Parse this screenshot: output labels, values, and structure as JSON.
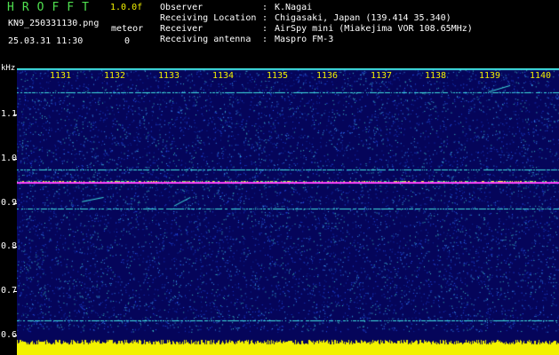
{
  "header": {
    "app_title": "HROFFT",
    "version": "1.0.0f",
    "filename": "KN9_250331130.png",
    "meteor_label": "meteor",
    "timestamp": "25.03.31 11:30",
    "meteor_count": "0"
  },
  "metadata": [
    {
      "key": "Observer",
      "sep": ":",
      "value": "K.Nagai"
    },
    {
      "key": "Receiving Location",
      "sep": ":",
      "value": "Chigasaki, Japan (139.414 35.340)"
    },
    {
      "key": "Receiver",
      "sep": ":",
      "value": "AirSpy mini (Miakejima VOR 108.65MHz)"
    },
    {
      "key": "Receiving antenna",
      "sep": ":",
      "value": "Maspro FM-3"
    }
  ],
  "colors": {
    "background": "#000000",
    "plot_background": "#05055a",
    "title_green": "#4fe04f",
    "label_yellow": "#f2f200",
    "signal_cyan": "#3fe0e0",
    "signal_magenta": "#ff40ff",
    "noise_yellow": "#f2f200"
  },
  "chart_data": {
    "type": "heatmap",
    "ylabel": "kHz",
    "y_ticks": [
      "1.1",
      "1.0",
      "0.9",
      "0.8",
      "0.7",
      "0.6"
    ],
    "y_tick_values": [
      1.1,
      1.0,
      0.9,
      0.8,
      0.7,
      0.6
    ],
    "ylim": [
      0.575,
      1.2
    ],
    "x_ticks": [
      "1131",
      "1132",
      "1133",
      "1134",
      "1135",
      "1136",
      "1137",
      "1138",
      "1139",
      "1140"
    ],
    "x_tick_values": [
      1131,
      1132,
      1133,
      1134,
      1135,
      1136,
      1137,
      1138,
      1139,
      1140
    ],
    "xlim": [
      1130.4,
      1140.4
    ],
    "horizontal_lines": [
      {
        "freq": 1.2,
        "color": "#3fe0e0",
        "strong": true
      },
      {
        "freq": 1.145,
        "color": "#3fe0e0",
        "strong": false
      },
      {
        "freq": 0.965,
        "color": "#3fe0e0",
        "strong": false
      },
      {
        "freq": 0.935,
        "color": "#ff40ff",
        "strong": true
      },
      {
        "freq": 0.875,
        "color": "#3fe0e0",
        "strong": false
      },
      {
        "freq": 0.615,
        "color": "#3fe0e0",
        "strong": false
      }
    ],
    "meteor_traces": [
      {
        "x1": 1131.6,
        "y1": 0.89,
        "x2": 1132.0,
        "y2": 0.9
      },
      {
        "x1": 1133.3,
        "y1": 0.88,
        "x2": 1133.6,
        "y2": 0.9
      },
      {
        "x1": 1139.1,
        "y1": 1.145,
        "x2": 1139.5,
        "y2": 1.16
      }
    ]
  }
}
